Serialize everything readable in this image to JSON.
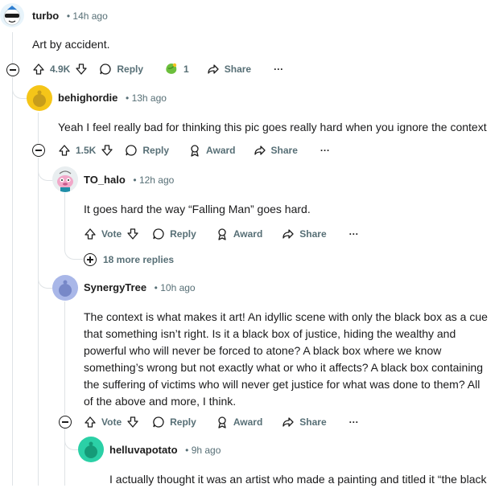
{
  "comments": [
    {
      "username": "turbo",
      "time": "14h ago",
      "body": "Art by accident.",
      "votes": "4.9K",
      "reply": "Reply",
      "award_count": "1",
      "share": "Share",
      "overflow": "···"
    },
    {
      "username": "behighordie",
      "time": "13h ago",
      "body": "Yeah I feel really bad for thinking this pic goes really hard when you ignore the context",
      "votes": "1.5K",
      "reply": "Reply",
      "award": "Award",
      "share": "Share",
      "overflow": "···"
    },
    {
      "username": "TO_halo",
      "time": "12h ago",
      "body": "It goes hard the way “Falling Man” goes hard.",
      "votes": "Vote",
      "reply": "Reply",
      "award": "Award",
      "share": "Share",
      "overflow": "···",
      "more_replies": "18 more replies"
    },
    {
      "username": "SynergyTree",
      "time": "10h ago",
      "body": "The context is what makes it art! An idyllic scene with only the black box as a cue that something isn’t right. Is it a black box of justice, hiding the wealthy and powerful who will never be forced to atone? A black box where we know something’s wrong but not exactly what or who it affects? A black box containing the suffering of victims who will never get justice for what was done to them? All of the above and more, I think.",
      "votes": "Vote",
      "reply": "Reply",
      "award": "Award",
      "share": "Share",
      "overflow": "···"
    },
    {
      "username": "helluvapotato",
      "time": "9h ago",
      "body": "I actually thought it was an artist who made a painting and titled it “the black"
    }
  ],
  "separator": "•",
  "colors": {
    "meta": "#576f76",
    "thread": "#dfe3e6",
    "text": "#1a1a1b"
  }
}
